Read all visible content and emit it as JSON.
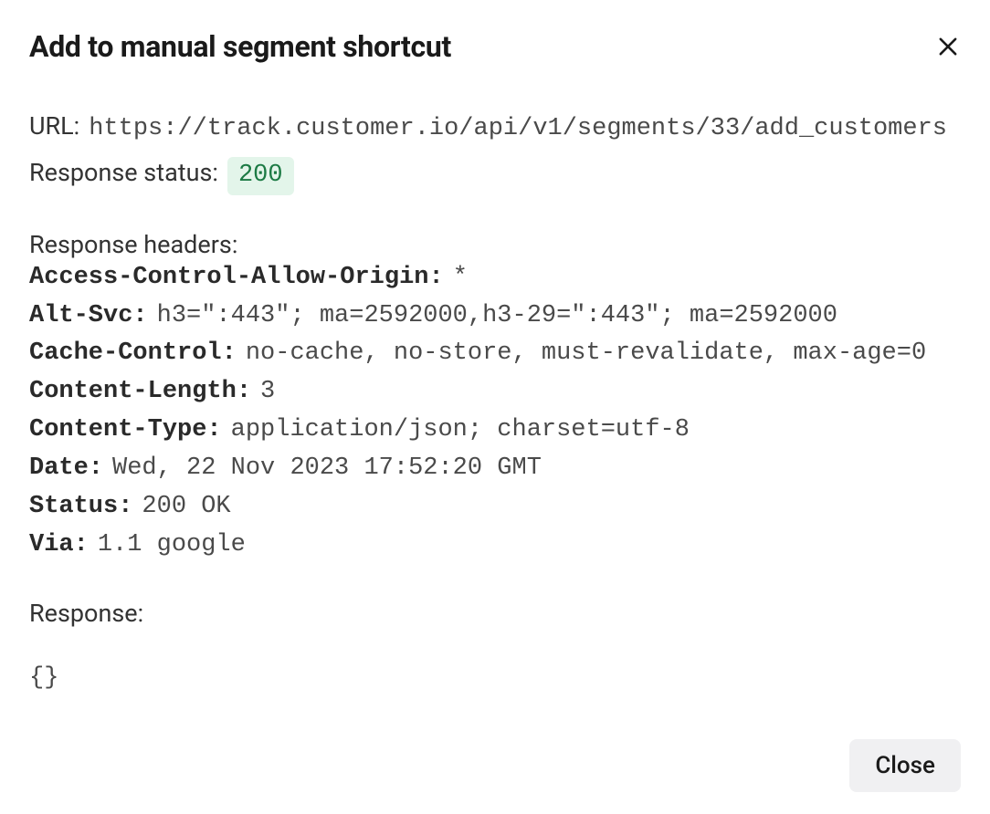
{
  "modal": {
    "title": "Add to manual segment shortcut",
    "close_label": "Close"
  },
  "request": {
    "url_label": "URL:",
    "url": "https://track.customer.io/api/v1/segments/33/add_customers",
    "status_label": "Response status:",
    "status_code": "200"
  },
  "headers_section": {
    "label": "Response headers:",
    "items": [
      {
        "key": "Access-Control-Allow-Origin:",
        "value": "*"
      },
      {
        "key": "Alt-Svc:",
        "value": "h3=\":443\"; ma=2592000,h3-29=\":443\"; ma=2592000"
      },
      {
        "key": "Cache-Control:",
        "value": "no-cache, no-store, must-revalidate, max-age=0"
      },
      {
        "key": "Content-Length:",
        "value": "3"
      },
      {
        "key": "Content-Type:",
        "value": "application/json; charset=utf-8"
      },
      {
        "key": "Date:",
        "value": "Wed, 22 Nov 2023 17:52:20 GMT"
      },
      {
        "key": "Status:",
        "value": "200 OK"
      },
      {
        "key": "Via:",
        "value": "1.1 google"
      }
    ]
  },
  "response_section": {
    "label": "Response:",
    "body": "{}"
  }
}
